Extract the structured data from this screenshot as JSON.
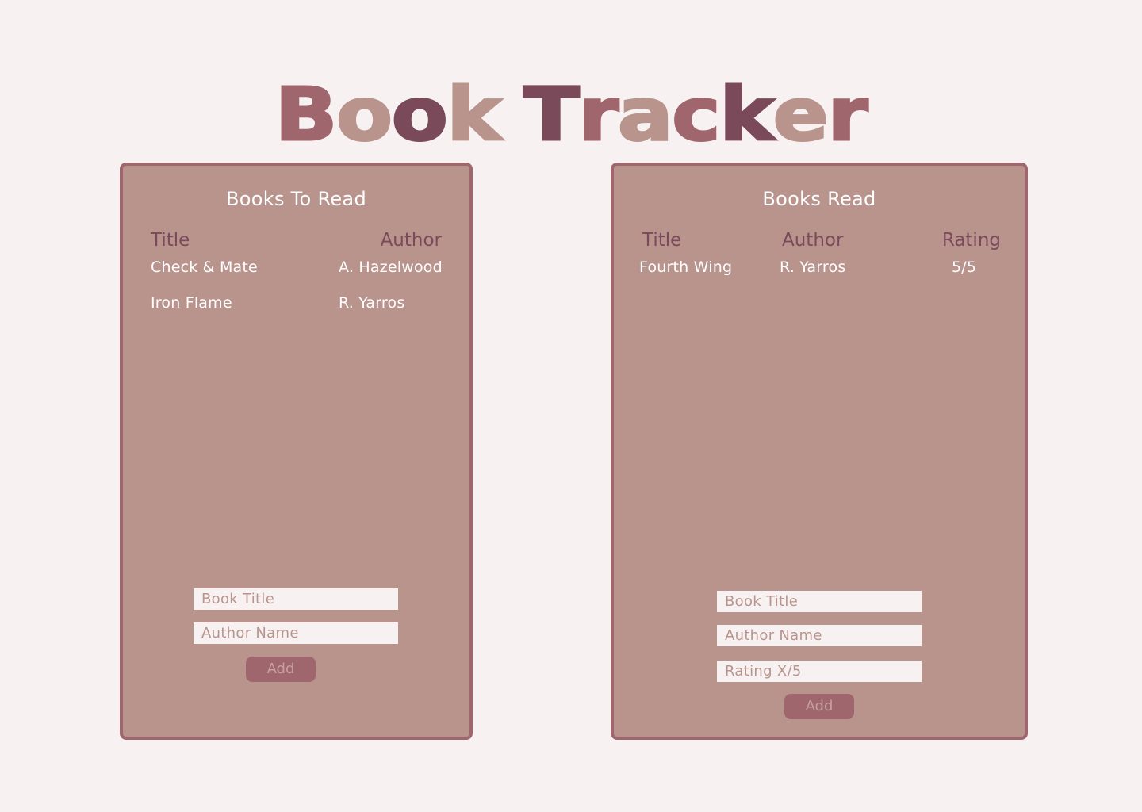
{
  "header": {
    "title_letters": [
      "B",
      "o",
      "o",
      "k",
      " ",
      "T",
      "r",
      "a",
      "c",
      "k",
      "e",
      "r"
    ],
    "title_colors": [
      "#a0666d",
      "#b8948d",
      "#7a4a5a",
      "#b8948d",
      "",
      "#7a4a5a",
      "#a0666d",
      "#b8948d",
      "#a0666d",
      "#7a4a5a",
      "#b8948d",
      "#a0666d"
    ]
  },
  "to_read": {
    "title": "Books To Read",
    "columns": {
      "title": "Title",
      "author": "Author"
    },
    "rows": [
      {
        "title": "Check & Mate",
        "author": "A. Hazelwood"
      },
      {
        "title": "Iron Flame",
        "author": "R. Yarros"
      }
    ],
    "form": {
      "title_placeholder": "Book Title",
      "author_placeholder": "Author Name",
      "add_label": "Add"
    }
  },
  "read": {
    "title": "Books Read",
    "columns": {
      "title": "Title",
      "author": "Author",
      "rating": "Rating"
    },
    "rows": [
      {
        "title": "Fourth Wing",
        "author": "R. Yarros",
        "rating": "5/5"
      }
    ],
    "form": {
      "title_placeholder": "Book Title",
      "author_placeholder": "Author Name",
      "rating_placeholder": "Rating X/5",
      "add_label": "Add"
    }
  },
  "colors": {
    "background": "#f7f2f1",
    "panel": "#b8948d",
    "panel_border": "#a0666d",
    "heading": "#7a4a5a",
    "text": "#ffffff"
  }
}
